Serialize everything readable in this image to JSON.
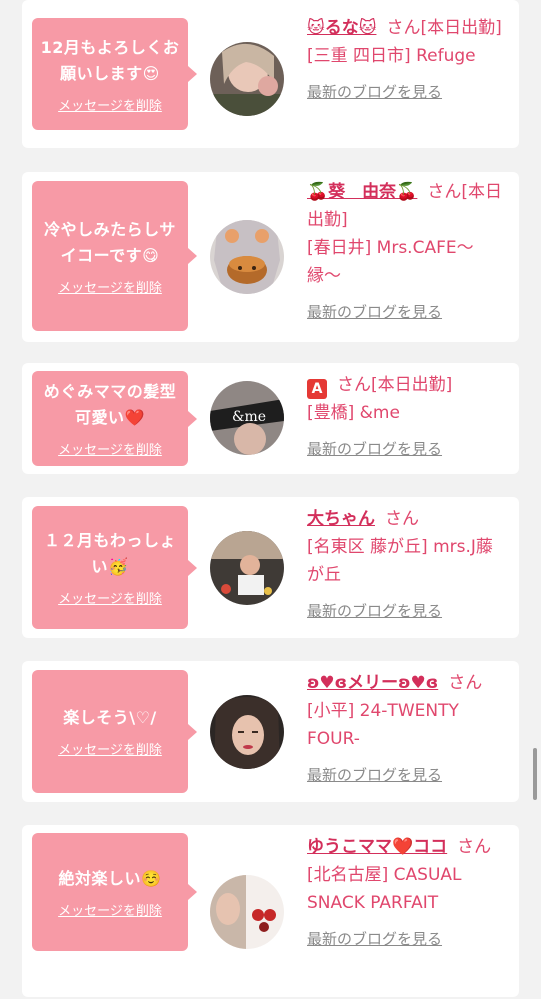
{
  "delete_label": "メッセージを削除",
  "blog_label": "最新のブログを見る",
  "san_suffix": "さん",
  "colors": {
    "bubble": "#f79aa6",
    "name": "#d32f5b",
    "text": "#e0476d",
    "link": "#8a8a8a"
  },
  "entries": [
    {
      "message": "12月もよろしくお願いします😍",
      "name": "🐱るな🐱",
      "status": "[本日出勤]",
      "shop": "[三重 四日市] Refuge"
    },
    {
      "message": "冷やしみたらしサイコーです😋",
      "name": "🍒葵　由奈🍒",
      "status": "[本日出勤]",
      "shop": "[春日井] Mrs.CAFE〜縁〜"
    },
    {
      "message": "めぐみママの髪型可愛い❤️",
      "name": "A",
      "status": "[本日出勤]",
      "shop": "[豊橋] &me"
    },
    {
      "message": "１２月もわっしょい🥳",
      "name": "大ちゃん",
      "status": "",
      "shop": "[名東区 藤が丘] mrs.J藤が丘"
    },
    {
      "message": "楽しそう\\♡/",
      "name": "ʚ♥ɞメリーʚ♥ɞ",
      "status": "",
      "shop": "[小平] 24-TWENTY FOUR-"
    },
    {
      "message": "絶対楽しい☺️",
      "name": "ゆうこママ❤️ココ",
      "status": "",
      "shop": "[北名古屋] CASUAL SNACK PARFAIT"
    }
  ]
}
